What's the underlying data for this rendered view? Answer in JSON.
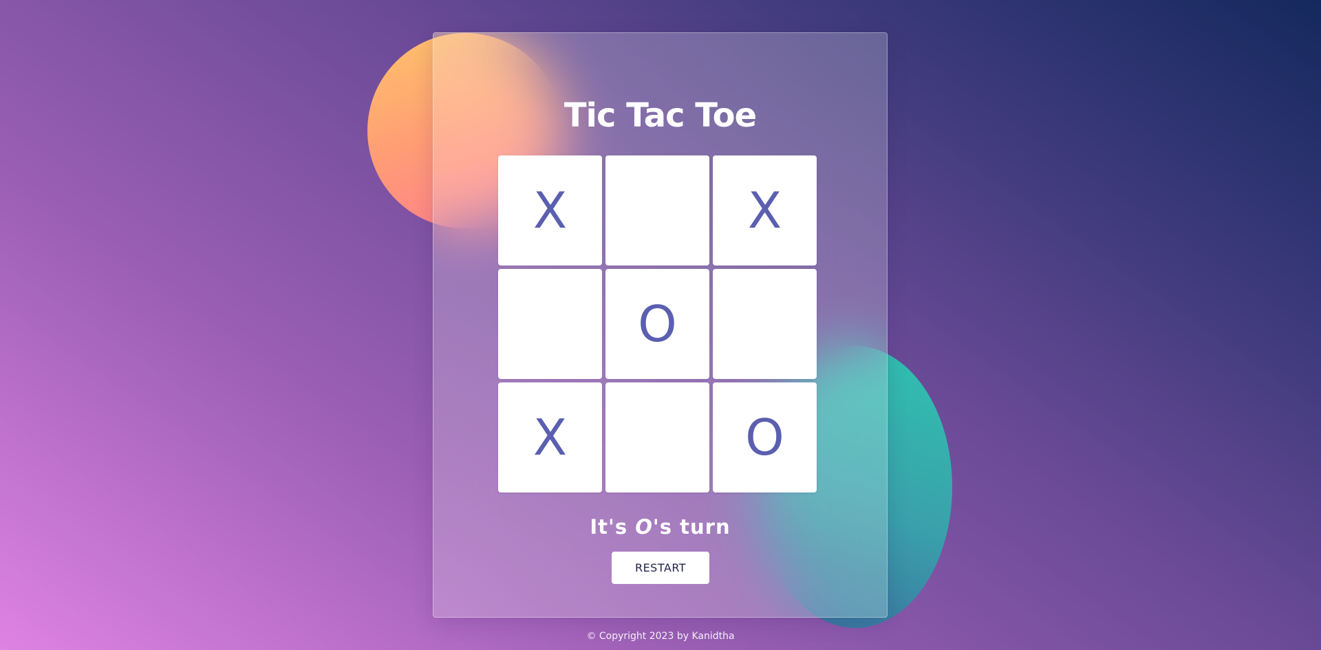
{
  "game": {
    "title": "Tic Tac Toe",
    "board": [
      "X",
      "",
      "X",
      "",
      "O",
      "",
      "X",
      "",
      "O"
    ],
    "status": {
      "prefix": "It's ",
      "player": "O",
      "suffix": "'s turn"
    },
    "restart_label": "RESTART"
  },
  "footer": {
    "copyright": "© Copyright 2023 by Kanidtha"
  },
  "colors": {
    "mark": "#5b5fb0",
    "cell": "#ffffff",
    "text": "#ffffff"
  }
}
